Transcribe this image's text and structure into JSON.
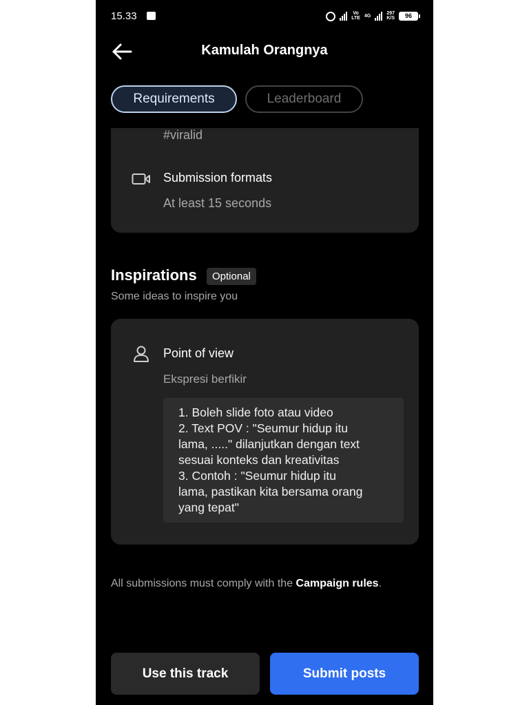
{
  "status_bar": {
    "time": "15.33",
    "network_top": "Vo",
    "network_bottom": "LTE",
    "network2_top": "4G",
    "speed_top": "297",
    "speed_bottom": "K/S",
    "battery": "96"
  },
  "header": {
    "title": "Kamulah Orangnya",
    "back_icon": "arrow-left-icon"
  },
  "tabs": [
    {
      "label": "Requirements",
      "active": true
    },
    {
      "label": "Leaderboard",
      "active": false
    }
  ],
  "requirements": {
    "hashtag": "#viralid",
    "formats_icon": "video-camera-icon",
    "formats_title": "Submission formats",
    "formats_value": "At least 15 seconds"
  },
  "inspirations": {
    "title": "Inspirations",
    "badge": "Optional",
    "subtitle": "Some ideas to inspire you",
    "card": {
      "icon": "person-icon",
      "title": "Point of view",
      "subtitle": "Ekspresi berfikir",
      "lines": [
        "1. Boleh slide foto atau video",
        "2. Text POV : \"Seumur hidup itu",
        "lama, .....\" dilanjutkan dengan text",
        "sesuai konteks dan kreativitas",
        "3. Contoh :  \"Seumur hidup itu",
        "lama, pastikan kita bersama orang",
        "yang tepat\""
      ]
    }
  },
  "footer": {
    "rules_prefix": "All submissions must comply with the ",
    "rules_link": "Campaign rules",
    "rules_suffix": "."
  },
  "actions": {
    "use_track": "Use this track",
    "submit": "Submit posts"
  },
  "colors": {
    "background": "#000000",
    "card": "#222223",
    "accent": "#2f6ff0",
    "tab_active_border": "#bcd2ec"
  }
}
